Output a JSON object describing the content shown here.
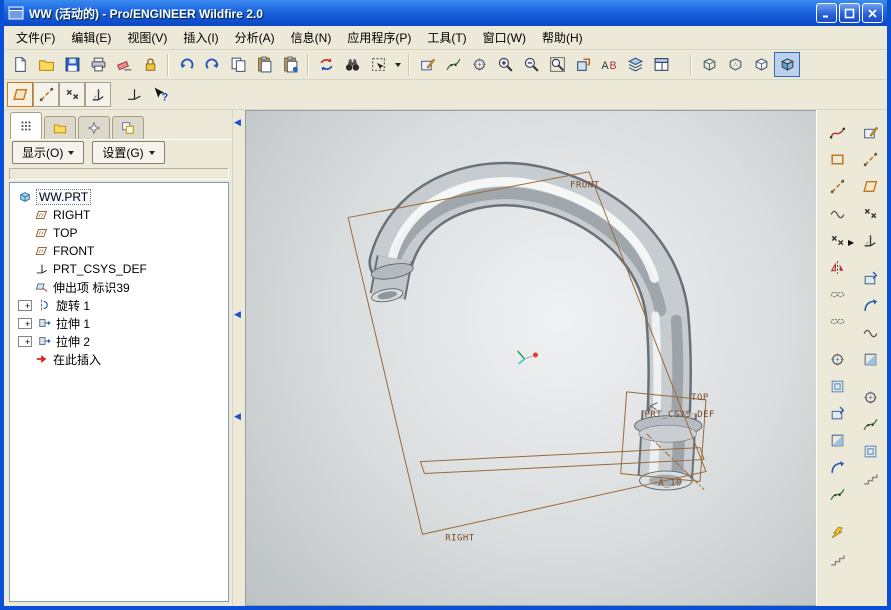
{
  "window": {
    "title": "WW (活动的) - Pro/ENGINEER Wildfire 2.0",
    "controls": [
      "minimize",
      "maximize",
      "close"
    ]
  },
  "menus": [
    "文件(F)",
    "编辑(E)",
    "视图(V)",
    "插入(I)",
    "分析(A)",
    "信息(N)",
    "应用程序(P)",
    "工具(T)",
    "窗口(W)",
    "帮助(H)"
  ],
  "toolbars": {
    "main_icons": [
      "new",
      "open",
      "save",
      "print",
      "erase-display",
      "lock",
      "undo",
      "redo",
      "copy",
      "paste",
      "paste-special",
      "regenerate",
      "find",
      "select-filter",
      "select-filter-dropdown",
      "datum-plane-display",
      "datum-axis-display",
      "datum-point-display",
      "zoom-in",
      "zoom-out",
      "refit",
      "reorient",
      "annotation",
      "layers",
      "view-manager",
      "wireframe",
      "hidden-line",
      "no-hidden-line",
      "shaded"
    ],
    "sketch_icons": [
      "datum-plane-tool",
      "datum-axis-tool",
      "datum-point-tool",
      "datum-csys-tool",
      "datum-curve-tool",
      "context-help"
    ],
    "right_col1_icons": [
      "insert-datum-curve",
      "sketched-curve",
      "datum-axis",
      "wrap-curve",
      "datum-points",
      "offset-points",
      "copy-geometry",
      "merge-geometry",
      "hole-tool",
      "shell-tool",
      "draft-tool",
      "chamfer-tool",
      "round-tool",
      "section-sweep",
      "boundary-blend",
      "style-tool"
    ],
    "right_col2_icons": [
      "datum-plane",
      "datum-axis-2",
      "sketch-tool",
      "datum-point",
      "coordinate-system",
      "extrude-tool",
      "revolve-tool",
      "sweep-tool",
      "blend-tool",
      "hole-tool-2",
      "round-tool-2",
      "shell-tool-2",
      "rib-tool"
    ],
    "flyout_icon": "flyout-arrow"
  },
  "navigator": {
    "tabs": [
      "model-tree",
      "folder-browser",
      "favorites",
      "history"
    ],
    "show_button": "显示(O)",
    "settings_button": "设置(G)",
    "expander_glyph": "+",
    "tree": [
      {
        "label": "WW.PRT",
        "icon": "part"
      },
      {
        "label": "RIGHT",
        "icon": "datum-plane"
      },
      {
        "label": "TOP",
        "icon": "datum-plane"
      },
      {
        "label": "FRONT",
        "icon": "datum-plane"
      },
      {
        "label": "PRT_CSYS_DEF",
        "icon": "csys"
      },
      {
        "label": "伸出项 标识39",
        "icon": "protrusion"
      },
      {
        "label": "旋转 1",
        "icon": "revolve",
        "expandable": true
      },
      {
        "label": "拉伸 1",
        "icon": "extrude",
        "expandable": true
      },
      {
        "label": "拉伸 2",
        "icon": "extrude",
        "expandable": true
      },
      {
        "label": "在此插入",
        "icon": "insert-here"
      }
    ]
  },
  "viewport": {
    "labels": {
      "front": "FRONT",
      "top": "TOP",
      "right": "RIGHT",
      "csys": "PRT_CSYS_DEF",
      "axis": "A_10"
    }
  },
  "colors": {
    "titlebar_top": "#3a8bf0",
    "titlebar_bottom": "#0a47c4",
    "toolbar_bg": "#ece9d8",
    "datum_outline": "#9a6a38",
    "datum_label": "#7b4a26",
    "viewport_center": "#f0f1f2",
    "viewport_edge": "#bcc1c3",
    "insert_arrow": "#d42a1e"
  }
}
